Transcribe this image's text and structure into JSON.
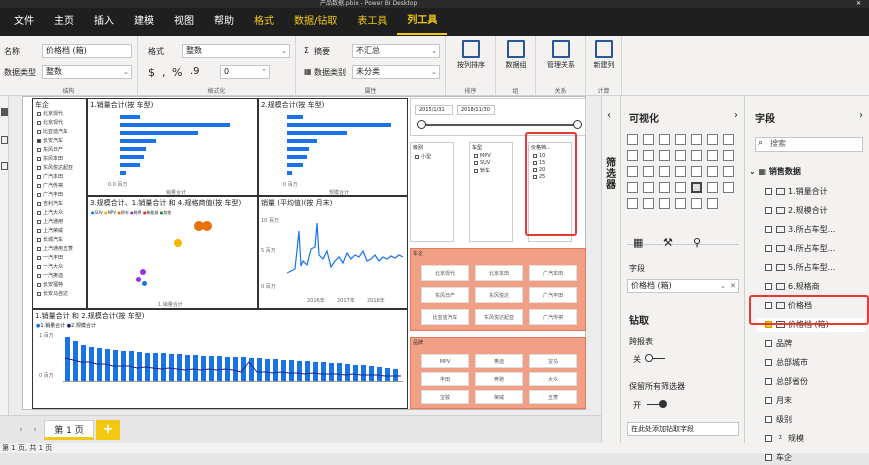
{
  "window": {
    "title": "产品数据.pbix - Power BI Desktop"
  },
  "menu": {
    "items": [
      "文件",
      "主页",
      "插入",
      "建模",
      "视图",
      "帮助",
      "格式",
      "数据/钻取",
      "表工具",
      "列工具"
    ]
  },
  "ribbon": {
    "name_label": "名称",
    "name_value": "价格档 (箱)",
    "datatype_label": "数据类型",
    "datatype_value": "整数",
    "format_label": "格式",
    "format_value": "整数",
    "currency_symbol": "$",
    "comma_symbol": ",",
    "percent_symbol": "%",
    "decimals_value": "0",
    "summarize_label": "摘要",
    "summarize_value": "不汇总",
    "category_label": "数据类别",
    "category_value": "未分类",
    "sort_label": "按列排序",
    "group_label": "数据组",
    "manage_label": "管理关系",
    "newcol_label": "新建列",
    "groups": [
      "结构",
      "格式化",
      "属性",
      "排序",
      "组",
      "关系",
      "计算"
    ]
  },
  "report": {
    "slicer_brand": {
      "title": "车企",
      "items": [
        "北京现代",
        "北京现代",
        "比亚迪汽车",
        "长安汽车",
        "东风日产",
        "东风本田",
        "东风悦达起亚",
        "广汽本田",
        "广汽传祺",
        "广汽丰田",
        "吉利汽车",
        "上汽大众",
        "上汽通用",
        "上汽荣威",
        "长城汽车",
        "上汽通用五菱",
        "一汽丰田",
        "一汽大众",
        "一汽奥迪",
        "长安福特",
        "长安马自达"
      ]
    },
    "chart1": {
      "title": "1.销量合计(按 车型)",
      "axis": "销量合计",
      "tick": "0.0 百万"
    },
    "chart2": {
      "title": "2.规模合计(按 车型)",
      "axis": "规模合计",
      "tick": "0 百万"
    },
    "chart3": {
      "title": "3.规模合计、1.销量合计 和 4.规格商值(按 车型)",
      "legend": [
        "SUV",
        "MPV",
        "轿车",
        "跨界",
        "新能源",
        "其他"
      ],
      "xlabel": "1.销量合计"
    },
    "chart4": {
      "title": "销量 (平均值)(按 月末)",
      "x_ticks": [
        "2016年",
        "2017年",
        "2018年"
      ],
      "y_ticks": [
        "10 百万",
        "5 百万",
        "0 百万"
      ]
    },
    "chart5": {
      "title": "1.销量合计 和 2.规模合计(按 车型)",
      "legend": [
        "1.销量合计",
        "2.规模合计"
      ],
      "y_ticks": [
        "1 百万",
        "0 百万"
      ]
    },
    "date_slicer": {
      "start": "2015/1/31",
      "end": "2018/11/30"
    },
    "slicer_level": {
      "title": "级别",
      "items": [
        "小型"
      ]
    },
    "slicer_type": {
      "title": "车型",
      "items": [
        "MPV",
        "SUV",
        "轿车"
      ]
    },
    "slicer_price": {
      "title": "价格档...",
      "items": [
        "10",
        "15",
        "20",
        "25"
      ]
    },
    "tiles_top": {
      "title": "车企",
      "items": [
        "北京现代",
        "北京本田",
        "广汽本田",
        "东风日产",
        "东风悦达",
        "广汽丰田",
        "比亚迪汽车",
        "东风悦达起亚",
        "广汽传祺"
      ]
    },
    "tiles_bottom": {
      "title": "品牌",
      "items": [
        "MPV",
        "奥迪",
        "宝马",
        "丰田",
        "奔驰",
        "大众",
        "宝骏",
        "荣威",
        "五菱"
      ]
    }
  },
  "pages": {
    "current": "第 1 页",
    "add": "+"
  },
  "status": {
    "text": "第 1 页, 共 1 页"
  },
  "filter_pane": {
    "label": "筛选器"
  },
  "viz_pane": {
    "title": "可视化",
    "field_tab_label": "字段",
    "field_well_value": "价格档 (箱)",
    "drill_title": "钻取",
    "cross_report": "跨报表",
    "off_label": "关",
    "keep_filters": "保留所有筛选器",
    "on_label": "开",
    "drop_hint": "在此处添加钻取字段"
  },
  "field_pane": {
    "title": "字段",
    "search_placeholder": "搜索",
    "table": "销售数据",
    "fields": [
      "1.销量合计",
      "2.规模合计",
      "3.所占车型...",
      "4.所占车型...",
      "5.所占车型...",
      "6.规格商",
      "价格档",
      "价格档 (箱)",
      "品牌",
      "总部城市",
      "总部省份",
      "月末",
      "级别",
      "规模",
      "车企"
    ]
  }
}
